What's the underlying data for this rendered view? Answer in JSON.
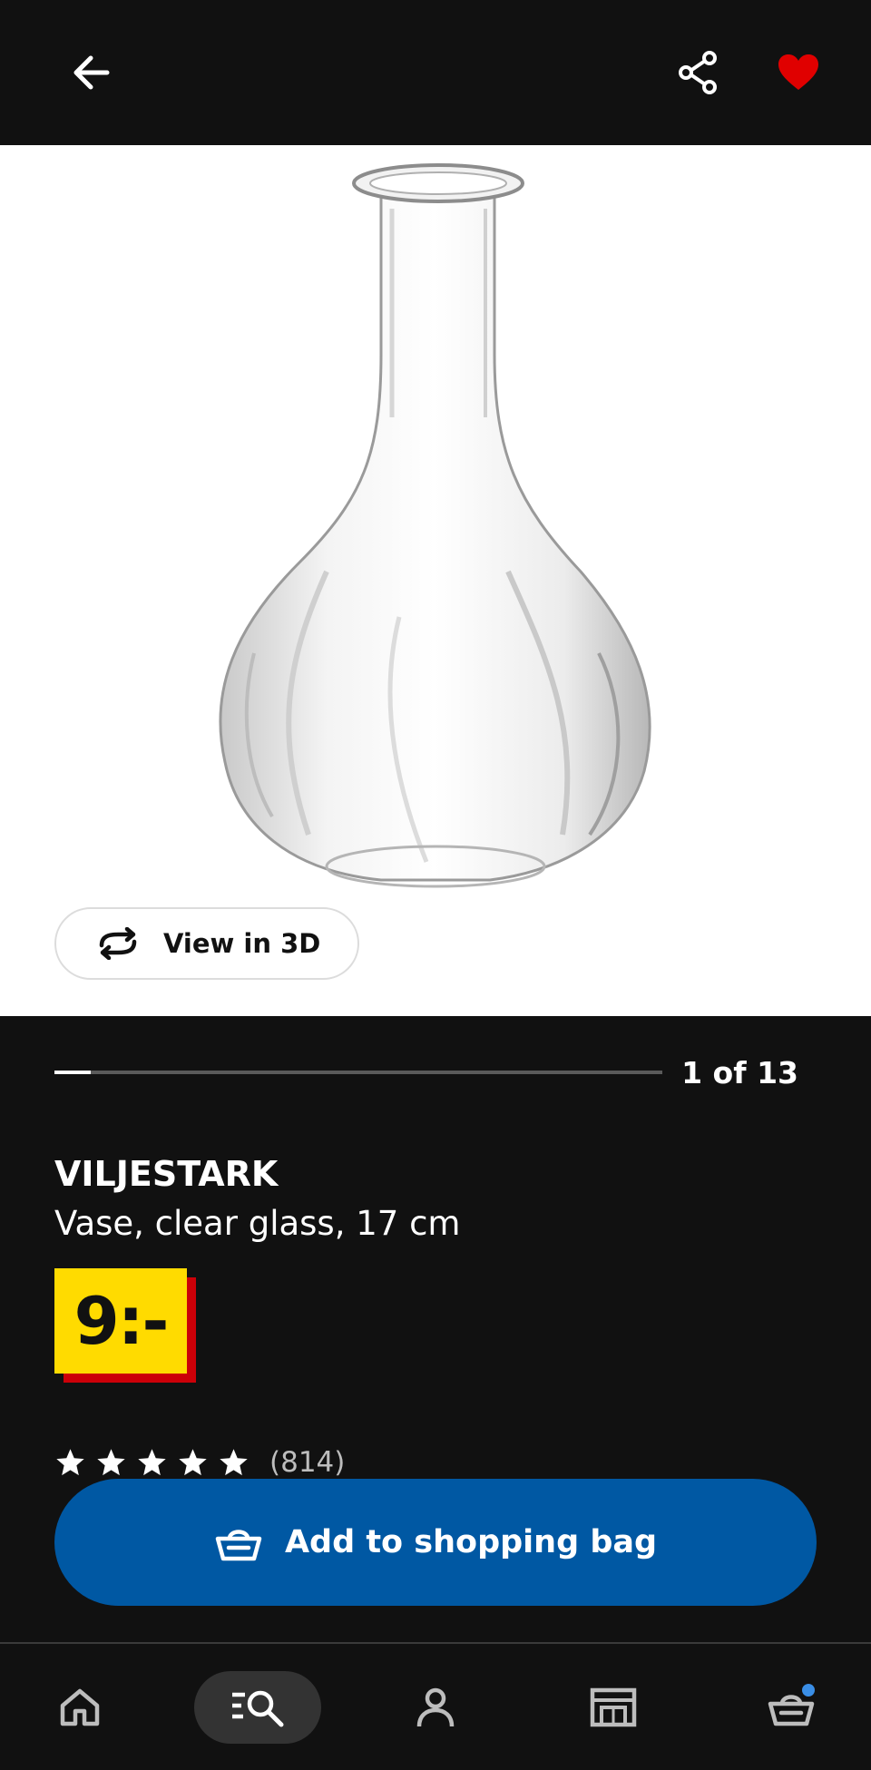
{
  "product": {
    "name": "VILJESTARK",
    "description": "Vase, clear glass, 17 cm",
    "price": "9:-",
    "rating_count": "(814)",
    "rating_stars": 5
  },
  "gallery": {
    "view_3d_label": "View in 3D",
    "counter": "1 of 13",
    "progress": 0.06
  },
  "actions": {
    "add_to_bag_label": "Add to shopping bag"
  },
  "icons": {
    "back": "arrow-left-icon",
    "share": "share-icon",
    "favorite": "heart-icon",
    "rotate": "rotate-3d-icon",
    "bag": "basket-icon",
    "nav": [
      "home-icon",
      "search-icon",
      "profile-icon",
      "store-icon",
      "basket-icon"
    ]
  },
  "colors": {
    "background": "#111111",
    "price_tag": "#ffdb00",
    "price_shadow": "#cc0008",
    "primary_button": "#0058a3",
    "favorite": "#e00000",
    "notification_dot": "#3a8ee6"
  }
}
